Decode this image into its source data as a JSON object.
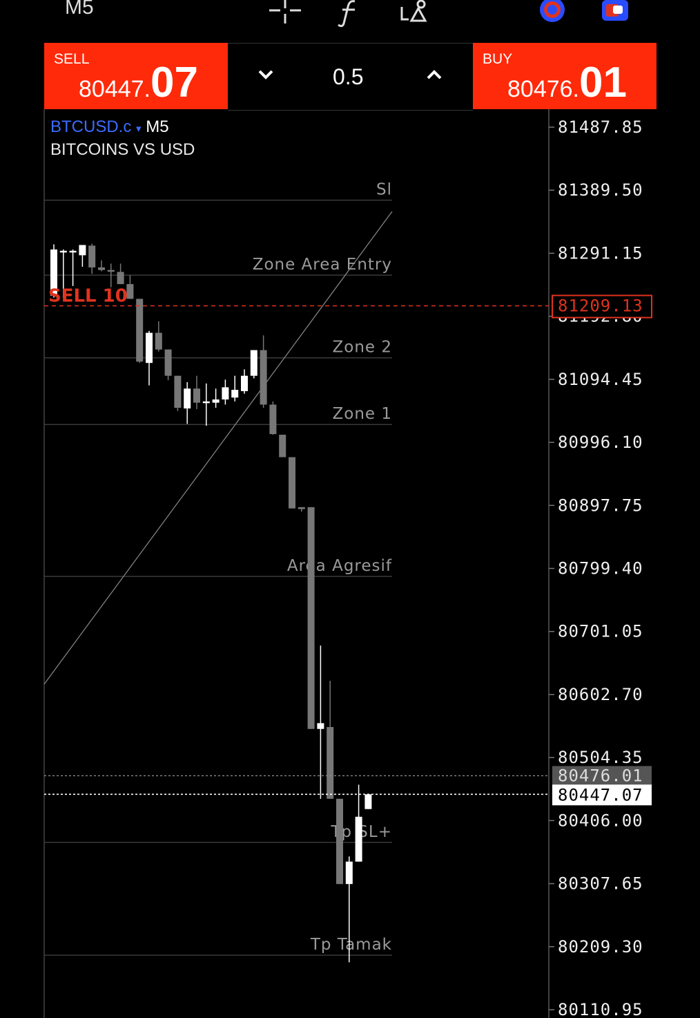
{
  "topbar": {
    "timeframe": "M5",
    "icons": [
      "crosshair-icon",
      "indicator-f-icon",
      "objects-icon",
      "clock-icon",
      "trade-icon"
    ]
  },
  "trade_panel": {
    "sell_label": "SELL",
    "sell_price_main": "80447.",
    "sell_price_big": "07",
    "buy_label": "BUY",
    "buy_price_main": "80476.",
    "buy_price_big": "01",
    "lot": "0.5"
  },
  "chart_header": {
    "symbol": "BTCUSD.c",
    "dropdown": "▾",
    "timeframe": "M5",
    "description": "BITCOINS VS USD"
  },
  "colors": {
    "sell_bg": "#ff2a0a",
    "buy_bg": "#ff2a0a",
    "accent_blue": "#3d6bff",
    "order_line": "#e0331f",
    "bull_candle": "#ffffff",
    "bear_candle": "#777777"
  },
  "price_axis": {
    "ticks": [
      "81487.85",
      "81389.50",
      "81291.15",
      "81192.80",
      "81094.45",
      "80996.10",
      "80897.75",
      "80799.40",
      "80701.05",
      "80602.70",
      "80504.35",
      "80406.00",
      "80307.65",
      "80209.30",
      "80110.95"
    ],
    "order_label": "81209.13",
    "ask_label": "80476.01",
    "bid_label": "80447.07"
  },
  "levels": [
    {
      "label": "Sl",
      "price": 81374
    },
    {
      "label": "Zone Area Entry",
      "price": 81257
    },
    {
      "label": "Zone 2",
      "price": 81128
    },
    {
      "label": "Zone 1",
      "price": 81024
    },
    {
      "label": "Area Agresif",
      "price": 80787
    },
    {
      "label": "Tp SL+",
      "price": 80372
    },
    {
      "label": "Tp Tamak",
      "price": 80196
    }
  ],
  "order": {
    "label": "SELL 10",
    "price": 81209.13
  },
  "chart_data": {
    "type": "candlestick",
    "symbol": "BTCUSD.c",
    "timeframe": "M5",
    "ylim": [
      80110.95,
      81487.85
    ],
    "candles": [
      {
        "o": 81225,
        "h": 81305,
        "l": 81222,
        "c": 81297
      },
      {
        "o": 81293,
        "h": 81297,
        "l": 81222,
        "c": 81295
      },
      {
        "o": 81293,
        "h": 81297,
        "l": 81240,
        "c": 81295
      },
      {
        "o": 81288,
        "h": 81301,
        "l": 81270,
        "c": 81304
      },
      {
        "o": 81303,
        "h": 81306,
        "l": 81259,
        "c": 81269
      },
      {
        "o": 81269,
        "h": 81280,
        "l": 81263,
        "c": 81265
      },
      {
        "o": 81265,
        "h": 81275,
        "l": 81238,
        "c": 81264
      },
      {
        "o": 81262,
        "h": 81275,
        "l": 81255,
        "c": 81243
      },
      {
        "o": 81243,
        "h": 81257,
        "l": 81220,
        "c": 81220
      },
      {
        "o": 81220,
        "h": 81220,
        "l": 81120,
        "c": 81122
      },
      {
        "o": 81120,
        "h": 81170,
        "l": 81085,
        "c": 81167
      },
      {
        "o": 81167,
        "h": 81185,
        "l": 81138,
        "c": 81141
      },
      {
        "o": 81141,
        "h": 81141,
        "l": 81093,
        "c": 81100
      },
      {
        "o": 81100,
        "h": 81100,
        "l": 81045,
        "c": 81050
      },
      {
        "o": 81049,
        "h": 81090,
        "l": 81025,
        "c": 81080
      },
      {
        "o": 81080,
        "h": 81100,
        "l": 81048,
        "c": 81058
      },
      {
        "o": 81060,
        "h": 81088,
        "l": 81022,
        "c": 81060
      },
      {
        "o": 81058,
        "h": 81080,
        "l": 81050,
        "c": 81063
      },
      {
        "o": 81063,
        "h": 81094,
        "l": 81055,
        "c": 81082
      },
      {
        "o": 81066,
        "h": 81100,
        "l": 81060,
        "c": 81078
      },
      {
        "o": 81076,
        "h": 81110,
        "l": 81072,
        "c": 81100
      },
      {
        "o": 81100,
        "h": 81140,
        "l": 81096,
        "c": 81140
      },
      {
        "o": 81140,
        "h": 81163,
        "l": 81050,
        "c": 81055
      },
      {
        "o": 81055,
        "h": 81060,
        "l": 81008,
        "c": 81009
      },
      {
        "o": 81008,
        "h": 81008,
        "l": 80973,
        "c": 80973
      },
      {
        "o": 80973,
        "h": 80965,
        "l": 80893,
        "c": 80893
      },
      {
        "o": 80895,
        "h": 80895,
        "l": 80888,
        "c": 80892
      },
      {
        "o": 80895,
        "h": 80895,
        "l": 80549,
        "c": 80549
      },
      {
        "o": 80549,
        "h": 80679,
        "l": 80440,
        "c": 80558
      },
      {
        "o": 80552,
        "h": 80624,
        "l": 80440,
        "c": 80440
      },
      {
        "o": 80440,
        "h": 80430,
        "l": 80307,
        "c": 80307
      },
      {
        "o": 80307,
        "h": 80350,
        "l": 80185,
        "c": 80342
      },
      {
        "o": 80342,
        "h": 80462,
        "l": 80342,
        "c": 80412
      },
      {
        "o": 80424,
        "h": 80448,
        "l": 80424,
        "c": 80447
      }
    ]
  }
}
